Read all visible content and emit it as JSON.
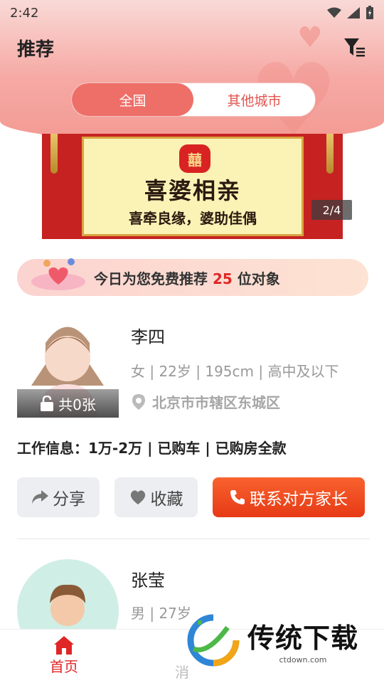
{
  "status_bar": {
    "time": "2:42"
  },
  "header": {
    "title": "推荐"
  },
  "region_tabs": [
    {
      "label": "全国",
      "active": true
    },
    {
      "label": "其他城市",
      "active": false
    }
  ],
  "banner": {
    "badge": "囍",
    "title": "喜婆相亲",
    "subtitle": "喜牵良缘，婆助佳偶",
    "counter": "2/4"
  },
  "recommend": {
    "prefix": "今日为您免费推荐 ",
    "count": "25",
    "suffix": " 位对象"
  },
  "profiles": [
    {
      "name": "李四",
      "info": "女 | 22岁 | 195cm | 高中及以下",
      "location": "北京市市辖区东城区",
      "photo_count": "共0张",
      "work": "工作信息：1万-2万 | 已购车 | 已购房全款",
      "share_label": "分享",
      "favorite_label": "收藏",
      "contact_label": "联系对方家长"
    },
    {
      "name": "张莹",
      "info": "男 | 27岁"
    }
  ],
  "tabbar": {
    "home_label": "首页",
    "partial_label": "消"
  },
  "watermark": {
    "title": "传统下载",
    "url": "ctdown.com"
  },
  "colors": {
    "accent": "#ee6e68",
    "brand_red": "#e02626",
    "contact_orange": "#f25a28"
  }
}
